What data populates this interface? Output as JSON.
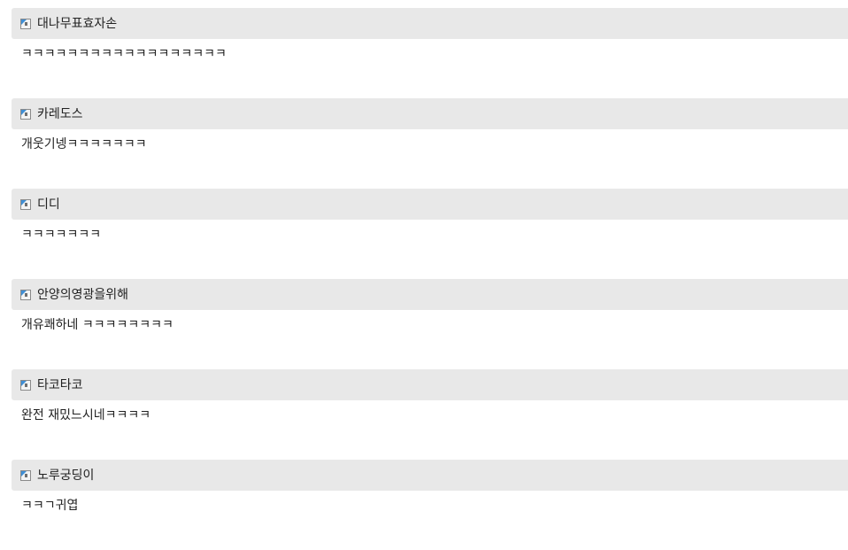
{
  "comments": [
    {
      "username": "대나무표효자손",
      "message": "ㅋㅋㅋㅋㅋㅋㅋㅋㅋㅋㅋㅋㅋㅋㅋㅋㅋㅋ",
      "icon": "user-avatar-icon"
    },
    {
      "username": "카레도스",
      "message": "개웃기넹ㅋㅋㅋㅋㅋㅋㅋ",
      "icon": "user-avatar-icon"
    },
    {
      "username": "디디",
      "message": "ㅋㅋㅋㅋㅋㅋㅋ",
      "icon": "user-avatar-icon"
    },
    {
      "username": "안양의영광을위해",
      "message": "개유쾌하네 ㅋㅋㅋㅋㅋㅋㅋㅋ",
      "icon": "user-avatar-icon"
    },
    {
      "username": "타코타코",
      "message": "완전 재밌느시네ㅋㅋㅋㅋ",
      "icon": "user-avatar-icon"
    },
    {
      "username": "노루궁딩이",
      "message": "ㅋㅋㄱ귀엽",
      "icon": "user-avatar-icon"
    }
  ],
  "colors": {
    "header_bg": "#e8e8e8",
    "icon_accent": "#3f8fd6",
    "text": "#222222"
  }
}
